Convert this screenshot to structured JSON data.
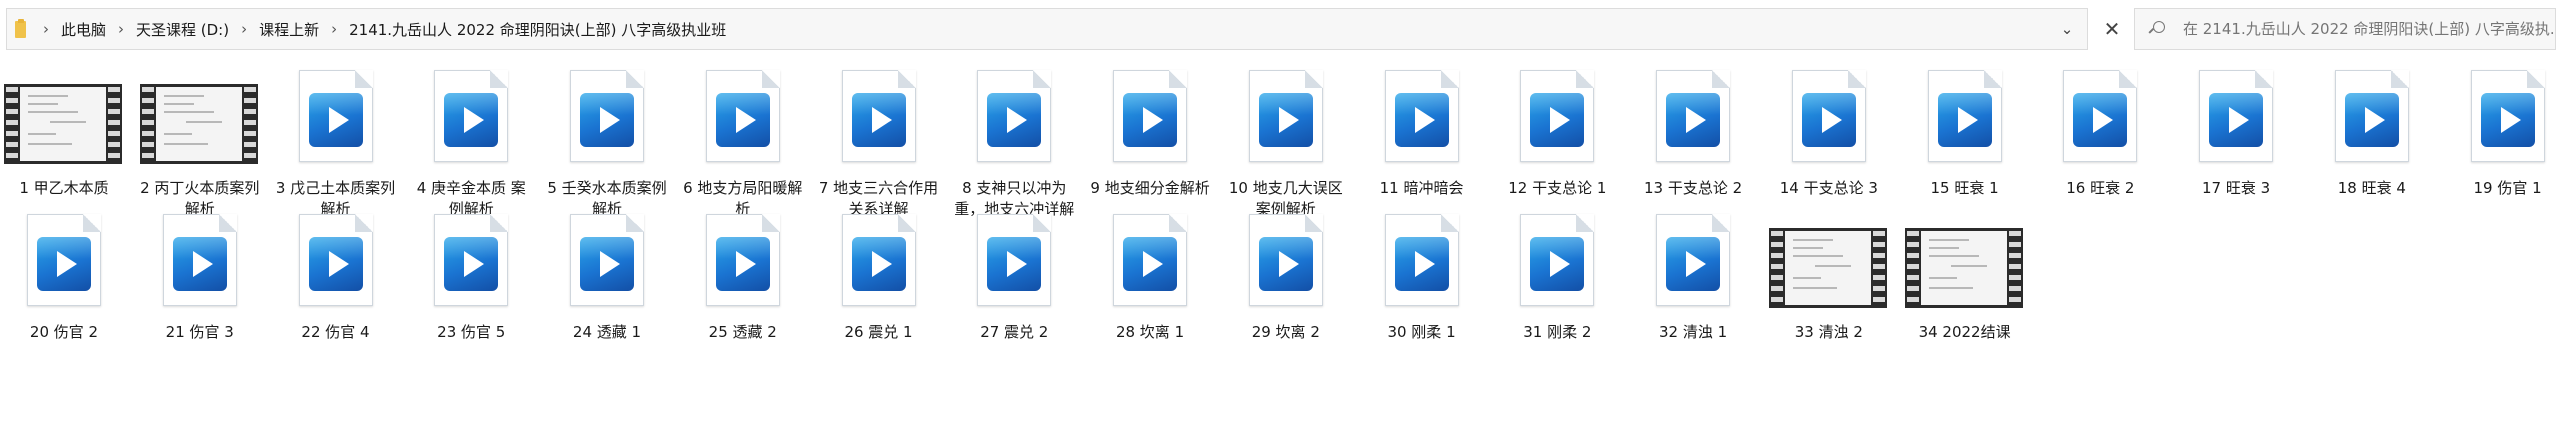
{
  "address_bar": {
    "breadcrumbs": [
      "此电脑",
      "天圣课程 (D:)",
      "课程上新",
      "2141.九岳山人 2022 命理阴阳诀(上部) 八字高级执业班"
    ],
    "dropdown_icon": "chevron-down-icon",
    "close_icon": "close-icon"
  },
  "search": {
    "placeholder": "在 2141.九岳山人 2022 命理阴阳诀(上部) 八字高级执..."
  },
  "files": [
    {
      "label": "1 甲乙木本质",
      "thumb": "film"
    },
    {
      "label": "2 丙丁火本质案列解析",
      "thumb": "film"
    },
    {
      "label": "3 戊己土本质案列解析",
      "thumb": "video"
    },
    {
      "label": "4 庚辛金本质 案例解析",
      "thumb": "video"
    },
    {
      "label": "5 壬癸水本质案例解析",
      "thumb": "video"
    },
    {
      "label": "6 地支方局阳暖解析",
      "thumb": "video"
    },
    {
      "label": "7 地支三六合作用关系详解",
      "thumb": "video"
    },
    {
      "label": "8 支神只以冲为重，地支六冲详解",
      "thumb": "video"
    },
    {
      "label": "9 地支细分金解析",
      "thumb": "video"
    },
    {
      "label": "10 地支几大误区案例解析",
      "thumb": "video"
    },
    {
      "label": "11 暗冲暗会",
      "thumb": "video"
    },
    {
      "label": "12 干支总论 1",
      "thumb": "video"
    },
    {
      "label": "13 干支总论 2",
      "thumb": "video"
    },
    {
      "label": "14 干支总论 3",
      "thumb": "video"
    },
    {
      "label": "15 旺衰 1",
      "thumb": "video"
    },
    {
      "label": "16 旺衰 2",
      "thumb": "video"
    },
    {
      "label": "17 旺衰 3",
      "thumb": "video"
    },
    {
      "label": "18 旺衰 4",
      "thumb": "video"
    },
    {
      "label": "19 伤官 1",
      "thumb": "video"
    },
    {
      "label": "20 伤官 2",
      "thumb": "video"
    },
    {
      "label": "21 伤官 3",
      "thumb": "video"
    },
    {
      "label": "22 伤官 4",
      "thumb": "video"
    },
    {
      "label": "23 伤官 5",
      "thumb": "video"
    },
    {
      "label": "24 透藏 1",
      "thumb": "video"
    },
    {
      "label": "25 透藏 2",
      "thumb": "video"
    },
    {
      "label": "26 震兑 1",
      "thumb": "video"
    },
    {
      "label": "27 震兑 2",
      "thumb": "video"
    },
    {
      "label": "28 坎离 1",
      "thumb": "video"
    },
    {
      "label": "29 坎离 2",
      "thumb": "video"
    },
    {
      "label": "30 刚柔 1",
      "thumb": "video"
    },
    {
      "label": "31 刚柔 2",
      "thumb": "video"
    },
    {
      "label": "32 清浊 1",
      "thumb": "video"
    },
    {
      "label": "33 清浊 2",
      "thumb": "film"
    },
    {
      "label": "34 2022结课",
      "thumb": "film"
    }
  ]
}
